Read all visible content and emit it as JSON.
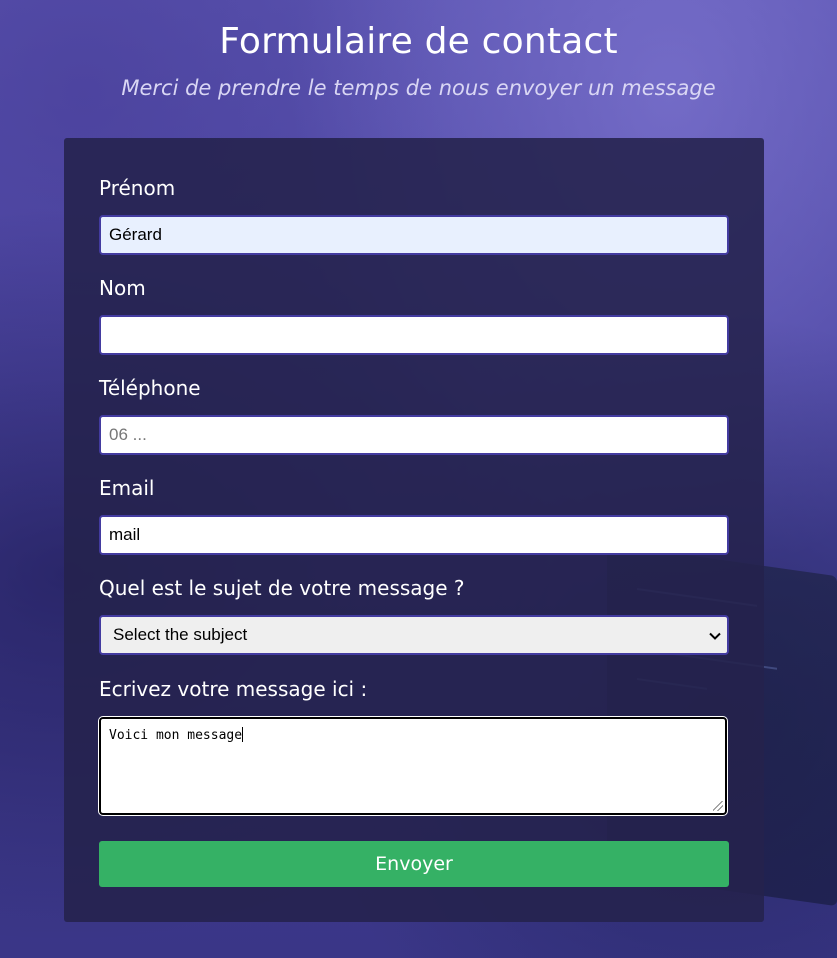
{
  "header": {
    "title": "Formulaire de contact",
    "subtitle": "Merci de prendre le temps de nous envoyer un message"
  },
  "form": {
    "firstname": {
      "label": "Prénom",
      "value": "Gérard",
      "placeholder": ""
    },
    "lastname": {
      "label": "Nom",
      "value": "",
      "placeholder": ""
    },
    "phone": {
      "label": "Téléphone",
      "value": "",
      "placeholder": "06 ..."
    },
    "email": {
      "label": "Email",
      "value": "mail",
      "placeholder": ""
    },
    "subject": {
      "label": "Quel est le sujet de votre message ?",
      "selected": "Select the subject"
    },
    "message": {
      "label": "Ecrivez votre message ici :",
      "value": "Voici mon message"
    },
    "submit_label": "Envoyer"
  },
  "colors": {
    "submit_button": "#35b165",
    "input_border": "#433ba0",
    "card_background": "#24224c"
  }
}
